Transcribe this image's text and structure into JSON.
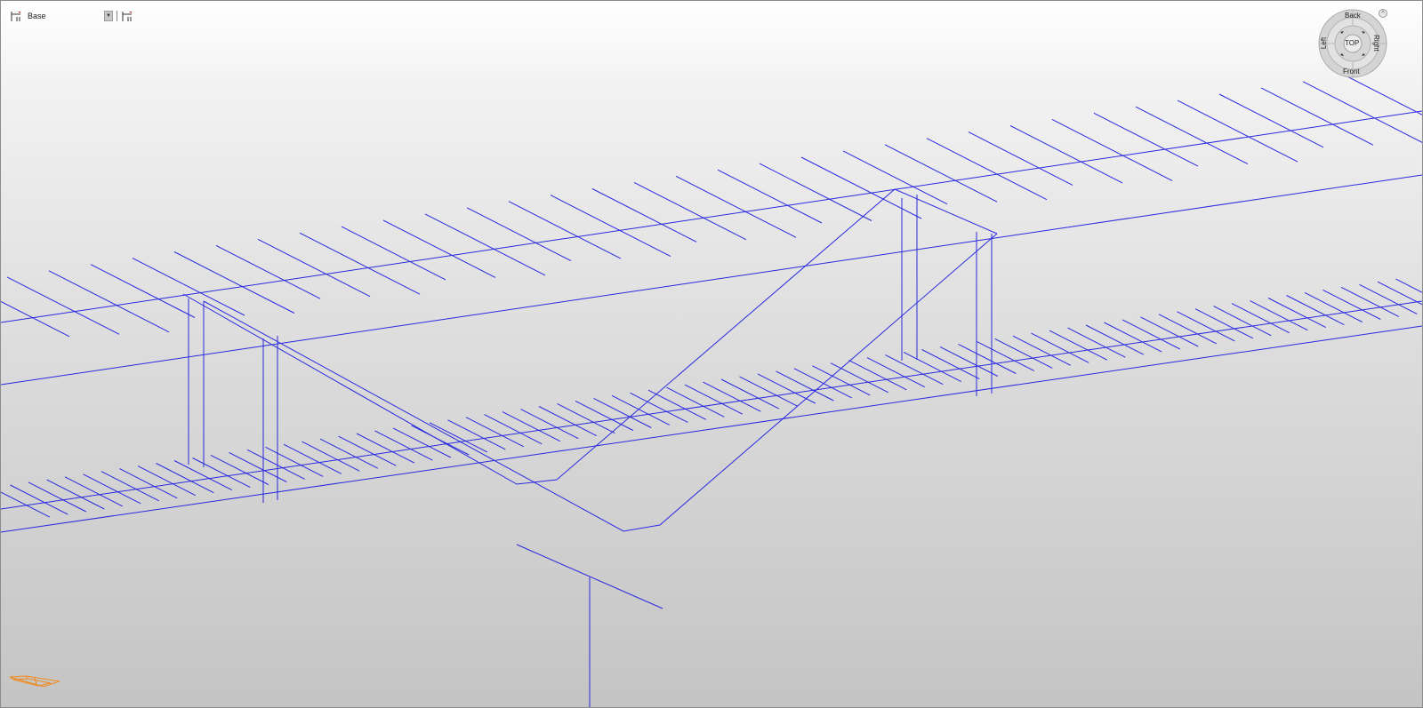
{
  "toolbar": {
    "level_name": "Base",
    "level_icon": "level-icon",
    "dropdown_icon": "chevron-down-icon",
    "level_settings_icon": "level-settings-icon"
  },
  "view_cube": {
    "top": "TOP",
    "back": "Back",
    "front": "Front",
    "left": "Left",
    "right": "Right",
    "home_icon": "chevron-up-icon"
  },
  "scene": {
    "line_color": "#2a2ae0"
  },
  "compass": {
    "icon": "compass-icon",
    "color": "#f08a1c"
  }
}
